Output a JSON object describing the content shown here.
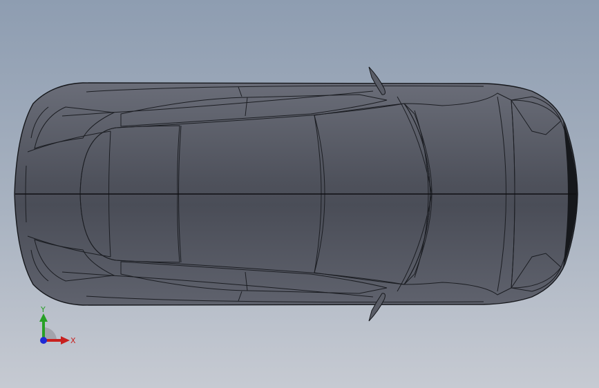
{
  "viewport": {
    "background_top": "#8e9db1",
    "background_bottom": "#c6cad2",
    "view": "top"
  },
  "model": {
    "name": "car-body",
    "body_color": "#4d505a",
    "edge_color": "#1b1d22"
  },
  "triad": {
    "x_label": "X",
    "y_label": "Y",
    "x_color": "#c8201e",
    "y_color": "#27a025",
    "z_color": "#1f2ad6"
  }
}
